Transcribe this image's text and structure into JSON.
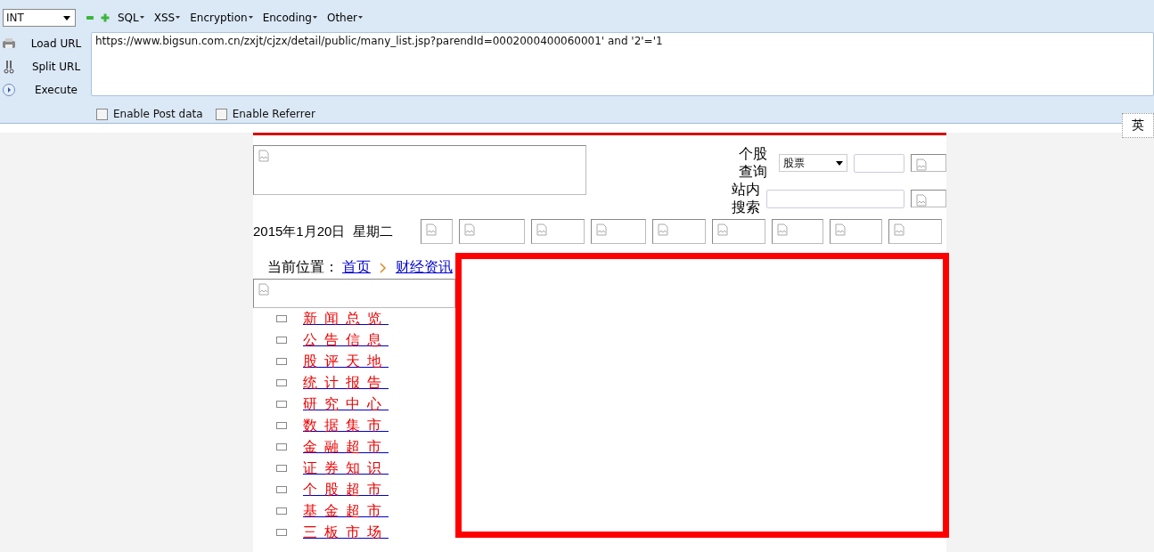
{
  "toolbar": {
    "type_select": "INT",
    "menus": [
      "SQL",
      "XSS",
      "Encryption",
      "Encoding",
      "Other"
    ],
    "actions": [
      {
        "label": "Load URL",
        "kind": "load"
      },
      {
        "label": "Split URL",
        "kind": "split"
      },
      {
        "label": "Execute",
        "kind": "execute"
      }
    ],
    "url": "https://www.bigsun.com.cn/zxjt/cjzx/detail/public/many_list.jsp?parendId=0002000400060001' and '2'='1",
    "options": [
      {
        "label": "Enable Post data",
        "checked": false
      },
      {
        "label": "Enable Referrer",
        "checked": false
      }
    ]
  },
  "ime_indicator": "英",
  "page": {
    "stock_query_label": "个股查询",
    "stock_select": "股票",
    "site_search_label": "站内搜索",
    "date": "2015年1月20日  星期二",
    "breadcrumb": {
      "label": "当前位置：",
      "links": [
        "首页",
        "财经资讯"
      ]
    },
    "nav_items": [
      "新闻总览",
      "公告信息",
      "股评天地",
      "统计报告",
      "研究中心",
      "数据集市",
      "金融超市",
      "证券知识",
      "个股超市",
      "基金超市",
      "三板市场"
    ]
  }
}
